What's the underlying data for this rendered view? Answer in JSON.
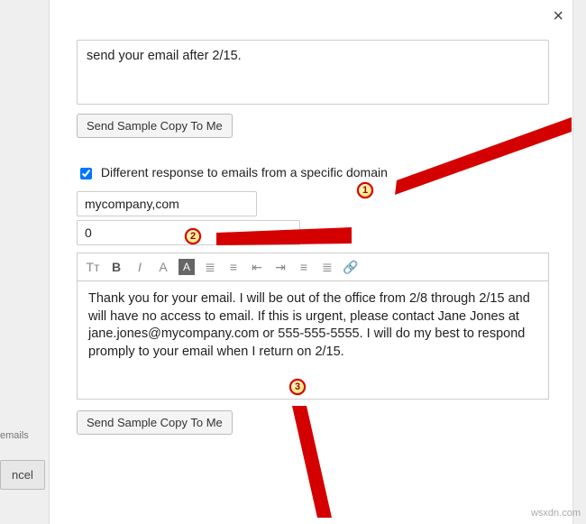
{
  "close_label": "×",
  "top_preview_text": "send your email after 2/15.",
  "btn_send_sample": "Send Sample Copy To Me",
  "checkbox": {
    "label": "Different response to emails from a specific domain"
  },
  "domain_input": {
    "value": "mycompany,com"
  },
  "num_input": {
    "value": "0"
  },
  "toolbar": {
    "tt": "Tᴛ",
    "bold": "B",
    "italic": "I",
    "font": "A",
    "hl": "A",
    "bullets": "≣",
    "numlist": "≡",
    "outdent": "⇤",
    "indent": "⇥",
    "align": "≡",
    "alignc": "≣",
    "link": "🔗"
  },
  "editor_body": "Thank you for your email. I will be out of the office from 2/8 through 2/15 and will have no access to email. If this is urgent, please contact Jane Jones at jane.jones@mycompany.com or 555-555-5555. I will do my best to respond promply to your email when I return on 2/15.",
  "sidebar_emails": "emails",
  "cancel": "ncel",
  "watermark": "wsxdn.com",
  "callouts": {
    "c1": "1",
    "c2": "2",
    "c3": "3"
  }
}
